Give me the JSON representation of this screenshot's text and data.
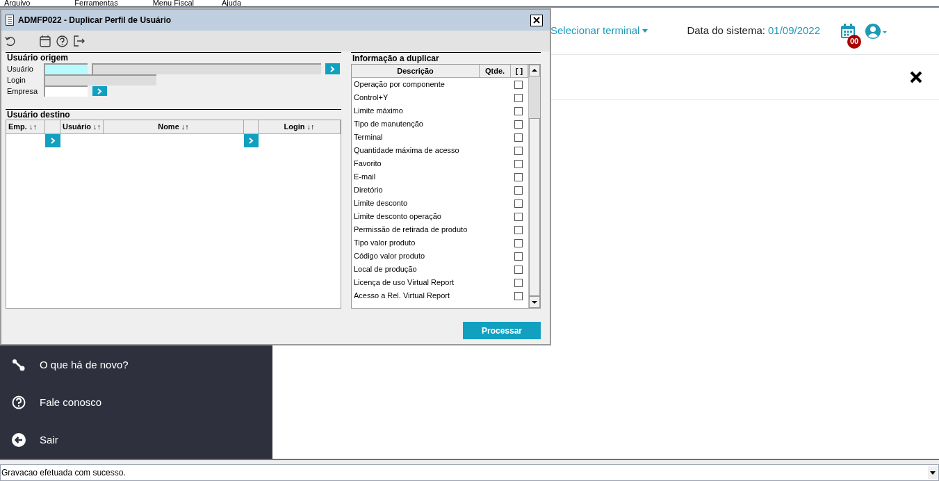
{
  "menu_bar": [
    "Arquivo",
    "Ferramentas",
    "Menu Fiscal",
    "Ajuda"
  ],
  "header": {
    "terminal_selector": "Selecionar terminal",
    "system_date_label": "Data do sistema:",
    "system_date": "01/09/2022",
    "calendar_badge": "00"
  },
  "sidebar": {
    "items": [
      {
        "label": "O que há de novo?",
        "kind": "news"
      },
      {
        "label": "Fale conosco",
        "kind": "help"
      },
      {
        "label": "Sair",
        "kind": "exit"
      }
    ]
  },
  "dialog": {
    "title": "ADMFP022 - Duplicar Perfil de Usuário",
    "origin": {
      "heading": "Usuário origem",
      "fields": [
        {
          "label": "Usuário",
          "kind": "lookup_with_description",
          "focused": true
        },
        {
          "label": "Login",
          "kind": "readonly",
          "focused": false
        },
        {
          "label": "Empresa",
          "kind": "lookup",
          "focused": false
        }
      ]
    },
    "destination": {
      "heading": "Usuário destino",
      "columns": [
        {
          "kind": "text",
          "label": "Emp. ↓↑"
        },
        {
          "kind": "button"
        },
        {
          "kind": "text",
          "label": "Usuário ↓↑"
        },
        {
          "kind": "text",
          "label": "Nome ↓↑"
        },
        {
          "kind": "button"
        },
        {
          "kind": "text",
          "label": "Login ↓↑"
        }
      ]
    },
    "info": {
      "heading": "Informação a duplicar",
      "columns": [
        "Descrição",
        "Qtde.",
        "[ ]"
      ],
      "rows": [
        {
          "label": "Operação por componente",
          "checked": false
        },
        {
          "label": "Control+Y",
          "checked": false
        },
        {
          "label": "Limite máximo",
          "checked": false
        },
        {
          "label": "Tipo de manutenção",
          "checked": false
        },
        {
          "label": "Terminal",
          "checked": false
        },
        {
          "label": "Quantidade máxima de acesso",
          "checked": false
        },
        {
          "label": "Favorito",
          "checked": false
        },
        {
          "label": "E-mail",
          "checked": false
        },
        {
          "label": "Diretório",
          "checked": false
        },
        {
          "label": "Limite desconto",
          "checked": false
        },
        {
          "label": "Limite desconto operação",
          "checked": false
        },
        {
          "label": "Permissão de retirada de produto",
          "checked": false
        },
        {
          "label": "Tipo valor produto",
          "checked": false
        },
        {
          "label": "Código valor produto",
          "checked": false
        },
        {
          "label": "Local de produção",
          "checked": false
        },
        {
          "label": "Licença de uso Virtual Report",
          "checked": false
        },
        {
          "label": "Acesso a Rel. Virtual Report",
          "checked": false
        }
      ]
    },
    "process_button": "Processar"
  },
  "status_bar": {
    "message": "Gravacao efetuada com sucesso."
  }
}
